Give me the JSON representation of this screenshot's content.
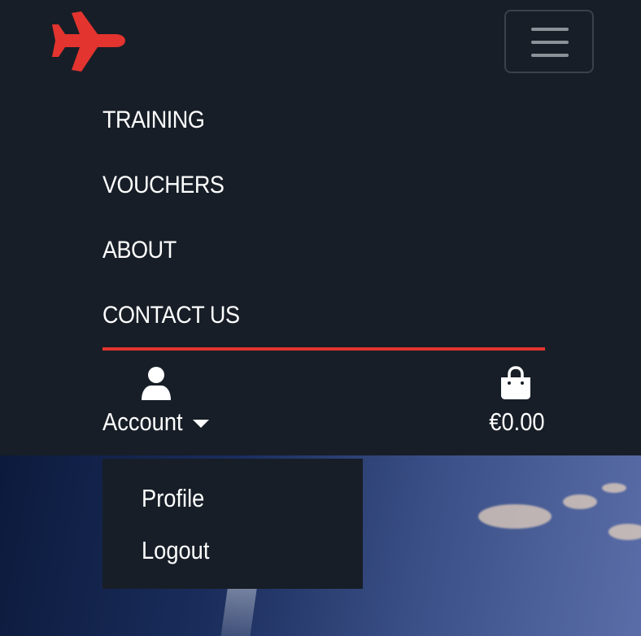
{
  "navbar": {
    "brand_icon": "airplane-icon",
    "toggler_icon": "hamburger-menu-icon",
    "links": [
      {
        "label": "TRAINING"
      },
      {
        "label": "VOUCHERS"
      },
      {
        "label": "ABOUT"
      },
      {
        "label": "CONTACT US"
      }
    ],
    "account": {
      "icon": "user-icon",
      "label": "Account",
      "caret_icon": "caret-down-icon",
      "menu": [
        {
          "label": "Profile"
        },
        {
          "label": "Logout"
        }
      ]
    },
    "bag": {
      "icon": "shopping-bag-icon",
      "total": "€0.00"
    }
  },
  "colors": {
    "background": "#171e27",
    "accent": "#e3342f",
    "text": "#ffffff",
    "toggler_border": "#3b414a"
  }
}
